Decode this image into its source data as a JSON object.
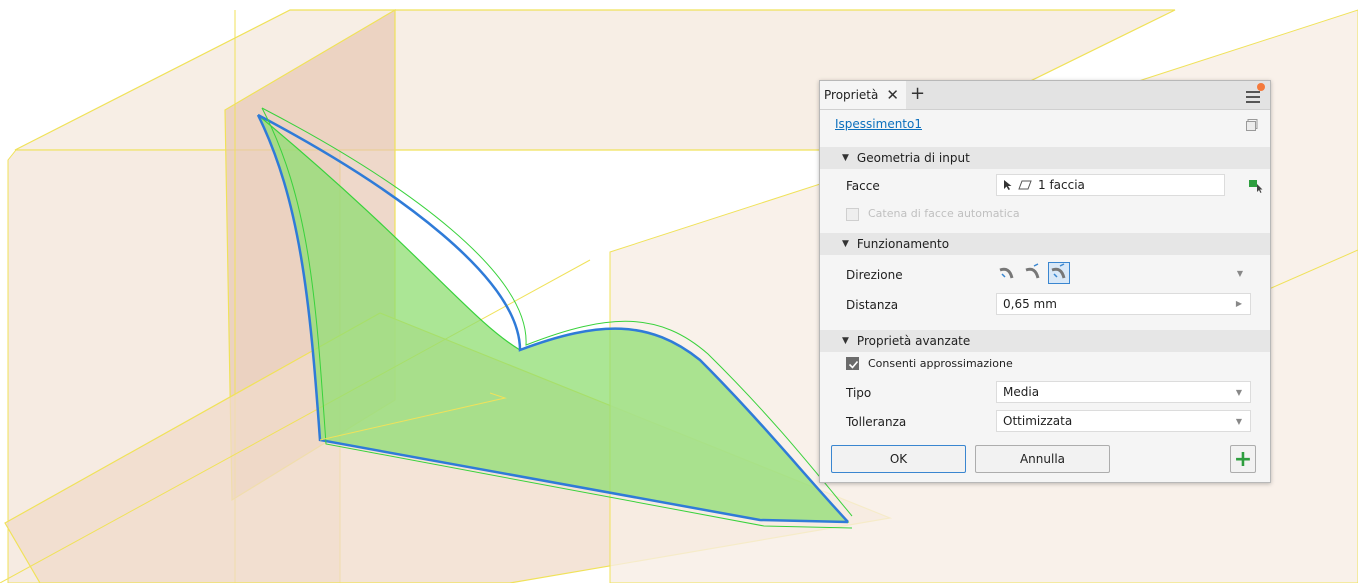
{
  "panel": {
    "tab_label": "Proprietà",
    "tab_close": "✕",
    "tab_add": "+",
    "feature_name": "Ispessimento1"
  },
  "sections": {
    "input_geometry": {
      "title": "Geometria di input",
      "faces_label": "Facce",
      "faces_value": "1 faccia",
      "chain_label": "Catena di facce automatica",
      "chain_checked": false,
      "chain_disabled": true
    },
    "operation": {
      "title": "Funzionamento",
      "direction_label": "Direzione",
      "direction_selected": "simmetrico",
      "distance_label": "Distanza",
      "distance_value": "0,65 mm"
    },
    "advanced": {
      "title": "Proprietà avanzate",
      "approx_label": "Consenti approssimazione",
      "approx_checked": true,
      "type_label": "Tipo",
      "type_value": "Media",
      "tolerance_label": "Tolleranza",
      "tolerance_value": "Ottimizzata"
    }
  },
  "buttons": {
    "ok": "OK",
    "cancel": "Annulla",
    "add": "+"
  },
  "colors": {
    "link": "#0b6fbd",
    "accent_add": "#2e9e3f",
    "face_fill": "#8fdd72",
    "edge_blue": "#2f7bd8",
    "plane_fill": "#f4e6d8",
    "plane_edge": "#f0e25a"
  }
}
